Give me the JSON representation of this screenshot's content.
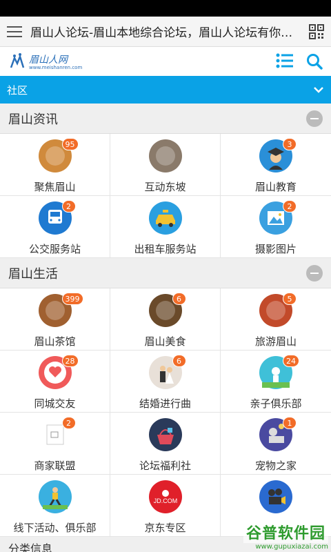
{
  "browser": {
    "title": "眉山人论坛-眉山本地综合论坛，眉山人论坛有你更..."
  },
  "site": {
    "logo_text": "眉山人网",
    "logo_sub": "www.meishanren.com"
  },
  "catbar": {
    "label": "社区"
  },
  "sections": [
    {
      "title": "眉山资讯",
      "items": [
        {
          "label": "聚焦眉山",
          "badge": "95",
          "icon": "city-photo-icon",
          "color": "#d08a3c"
        },
        {
          "label": "互动东坡",
          "badge": "",
          "icon": "statue-photo-icon",
          "color": "#8a7a6a"
        },
        {
          "label": "眉山教育",
          "badge": "3",
          "icon": "graduate-icon",
          "color": "#2a8fd8"
        },
        {
          "label": "公交服务站",
          "badge": "2",
          "icon": "bus-icon",
          "color": "#1f7ad1"
        },
        {
          "label": "出租车服务站",
          "badge": "",
          "icon": "taxi-icon",
          "color": "#2a9fe0"
        },
        {
          "label": "摄影图片",
          "badge": "2",
          "icon": "photo-icon",
          "color": "#3aa0e0"
        }
      ]
    },
    {
      "title": "眉山生活",
      "items": [
        {
          "label": "眉山茶馆",
          "badge": "399",
          "icon": "tea-icon",
          "color": "#a06030"
        },
        {
          "label": "眉山美食",
          "badge": "6",
          "icon": "food-icon",
          "color": "#6a4a2a"
        },
        {
          "label": "旅游眉山",
          "badge": "5",
          "icon": "travel-icon",
          "color": "#c24a2a"
        },
        {
          "label": "同城交友",
          "badge": "28",
          "icon": "heart-chat-icon",
          "color": "#f05a5a"
        },
        {
          "label": "结婚进行曲",
          "badge": "6",
          "icon": "wedding-icon",
          "color": "#e8e0d8"
        },
        {
          "label": "亲子俱乐部",
          "badge": "24",
          "icon": "family-icon",
          "color": "#3fc0d8"
        },
        {
          "label": "商家联盟",
          "badge": "2",
          "icon": "broken-image-icon",
          "color": "#ffffff"
        },
        {
          "label": "论坛福利社",
          "badge": "",
          "icon": "gift-basket-icon",
          "color": "#2a3a5a"
        },
        {
          "label": "宠物之家",
          "badge": "1",
          "icon": "pet-icon",
          "color": "#4a4aa0"
        },
        {
          "label": "线下活动、俱乐部",
          "badge": "",
          "icon": "runner-icon",
          "color": "#3ab0e0"
        },
        {
          "label": "京东专区",
          "badge": "",
          "icon": "jd-icon",
          "color": "#e0202a"
        },
        {
          "label": "",
          "badge": "",
          "icon": "projector-icon",
          "color": "#2a6ad0"
        }
      ]
    }
  ],
  "bottom_peek": {
    "title": "分类信息"
  },
  "watermark": {
    "main": "谷普软件园",
    "sub": "www.gupuxiazai.com"
  }
}
